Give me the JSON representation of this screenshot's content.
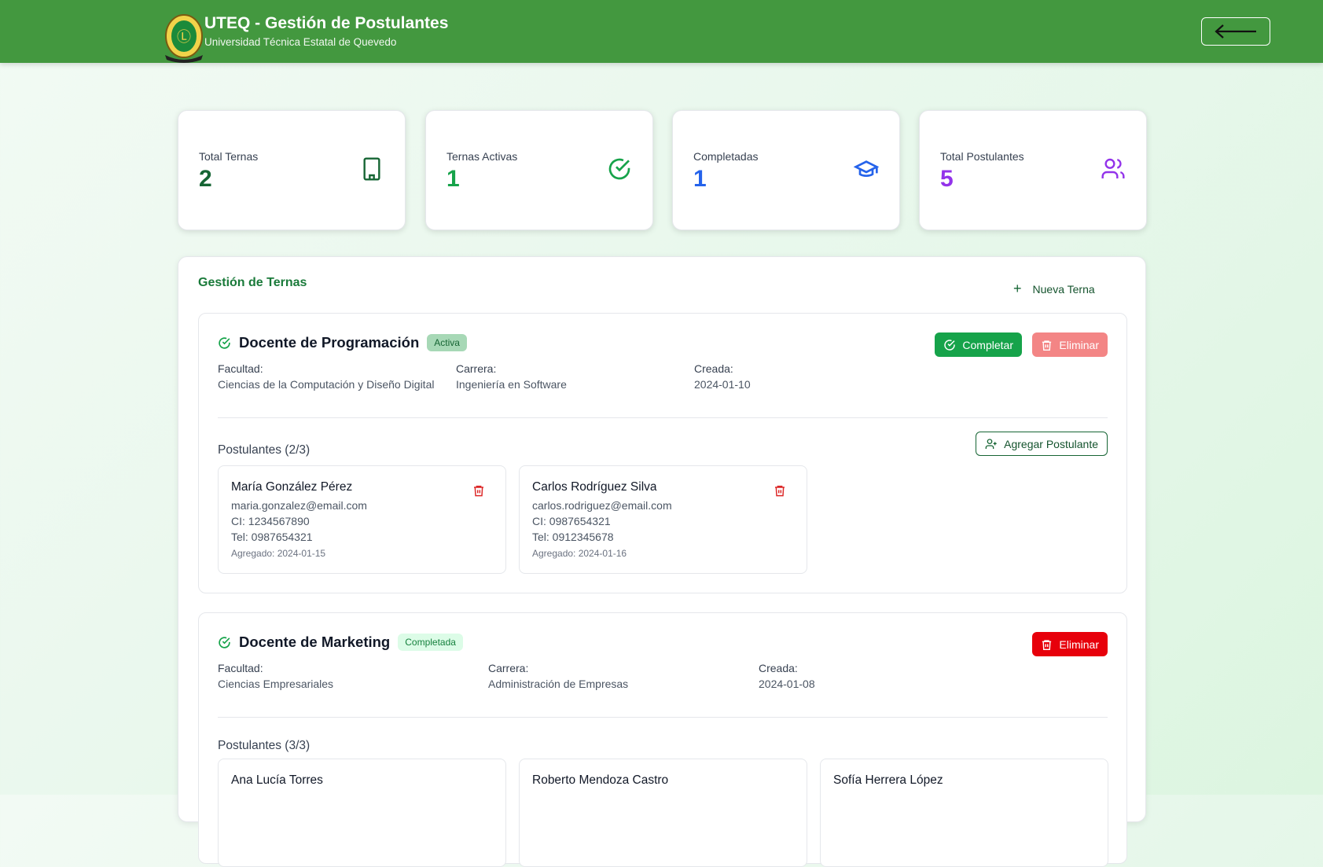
{
  "header": {
    "title": "UTEQ - Gestión de Postulantes",
    "subtitle": "Universidad Técnica Estatal de Quevedo",
    "back_icon": "arrow-left-icon"
  },
  "stats": [
    {
      "label": "Total Ternas",
      "value": "2",
      "color": "#166534",
      "icon": "building-icon"
    },
    {
      "label": "Ternas Activas",
      "value": "1",
      "color": "#16a34a",
      "icon": "check-circle-icon"
    },
    {
      "label": "Completadas",
      "value": "1",
      "color": "#2563eb",
      "icon": "graduation-cap-icon"
    },
    {
      "label": "Total Postulantes",
      "value": "5",
      "color": "#9333ea",
      "icon": "users-icon"
    }
  ],
  "panel": {
    "title": "Gestión de Ternas",
    "new_label": "Nueva Terna"
  },
  "labels": {
    "facultad": "Facultad:",
    "carrera": "Carrera:",
    "creada": "Creada:",
    "completar": "Completar",
    "eliminar": "Eliminar",
    "agregar": "Agregar Postulante"
  },
  "ternas": [
    {
      "name": "Docente de Programación",
      "status": "Activa",
      "facultad": "Ciencias de la Computación y Diseño Digital",
      "carrera": "Ingeniería en Software",
      "creada": "2024-01-10",
      "postulantes_label": "Postulantes (2/3)",
      "postulantes": [
        {
          "name": "María González Pérez",
          "email": "maria.gonzalez@email.com",
          "ci": "CI: 1234567890",
          "tel": "Tel: 0987654321",
          "added": "Agregado: 2024-01-15"
        },
        {
          "name": "Carlos Rodríguez Silva",
          "email": "carlos.rodriguez@email.com",
          "ci": "CI: 0987654321",
          "tel": "Tel: 0912345678",
          "added": "Agregado: 2024-01-16"
        }
      ]
    },
    {
      "name": "Docente de Marketing",
      "status": "Completada",
      "facultad": "Ciencias Empresariales",
      "carrera": "Administración de Empresas",
      "creada": "2024-01-08",
      "postulantes_label": "Postulantes (3/3)",
      "postulantes": [
        {
          "name": "Ana Lucía Torres"
        },
        {
          "name": "Roberto Mendoza Castro"
        },
        {
          "name": "Sofía Herrera López"
        }
      ]
    }
  ]
}
